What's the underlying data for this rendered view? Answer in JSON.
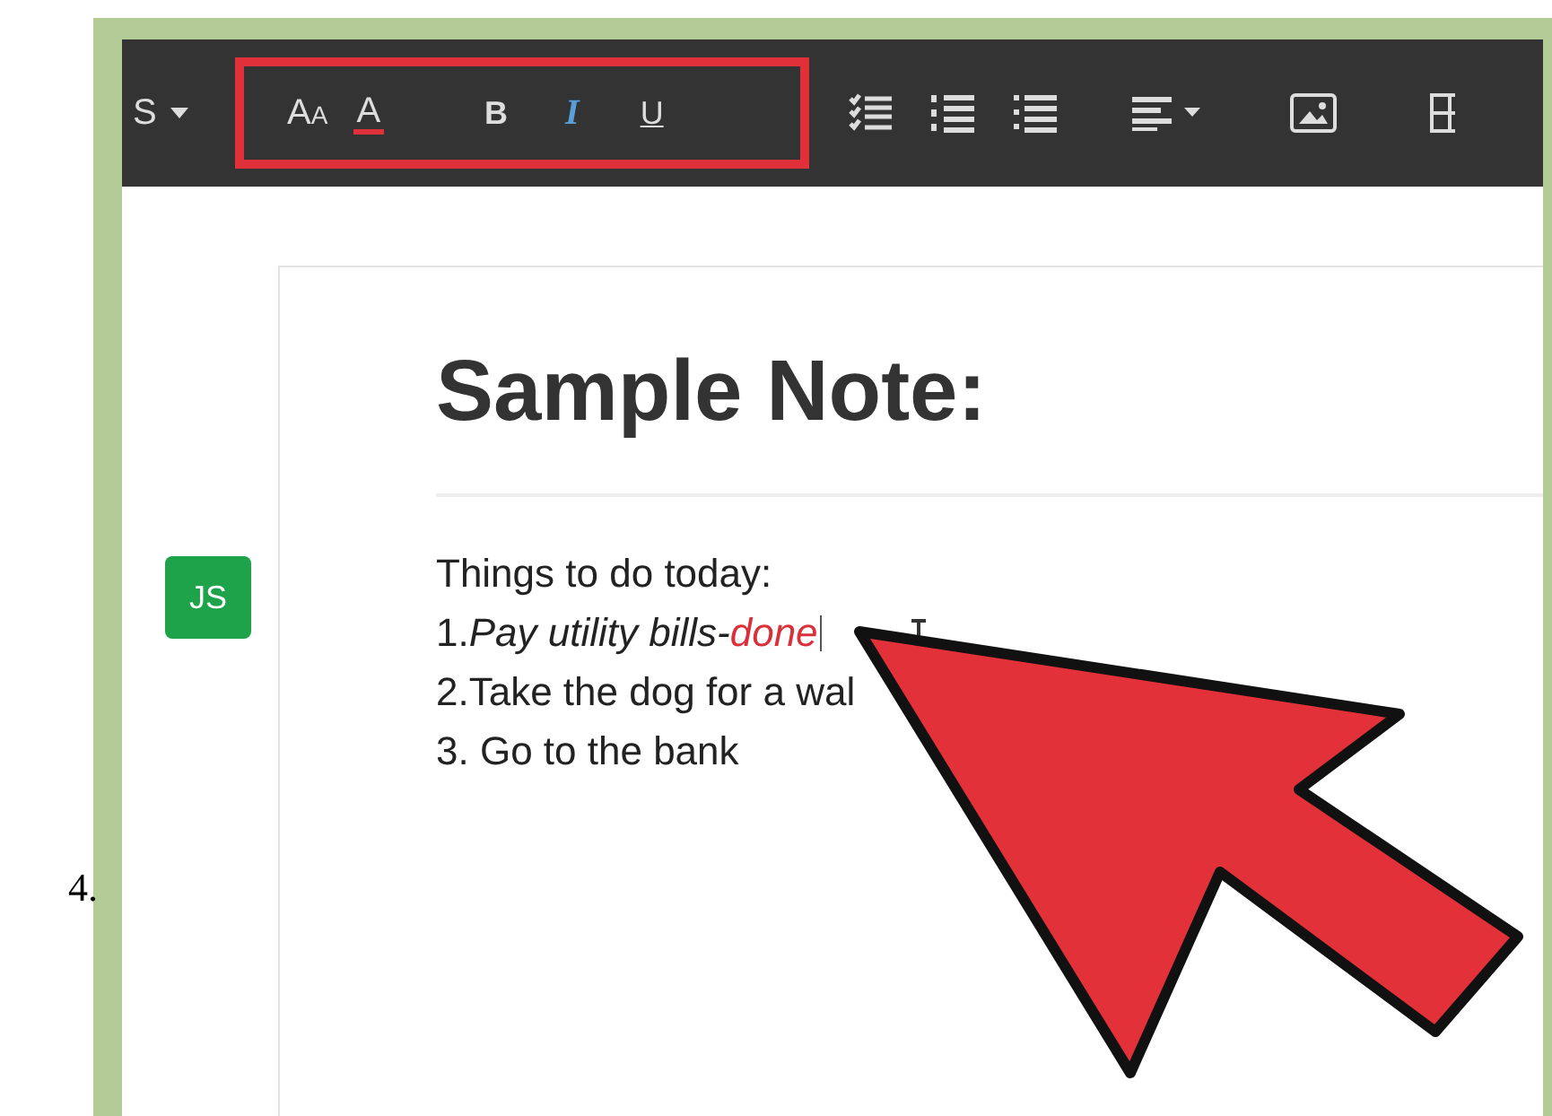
{
  "step": "4.",
  "toolbar": {
    "cut_label": "S",
    "format_buttons": [
      {
        "kind": "size",
        "label": "AA",
        "active": false
      },
      {
        "kind": "color",
        "label": "A",
        "active": false
      },
      {
        "kind": "bold",
        "label": "B",
        "active": false
      },
      {
        "kind": "italic",
        "label": "I",
        "active": true
      },
      {
        "kind": "underline",
        "label": "U",
        "active": false
      }
    ],
    "highlighted": true
  },
  "note": {
    "avatar": "JS",
    "title": "Sample Note:",
    "lines": [
      {
        "text": "Things to do today:"
      },
      {
        "prefix": "1.",
        "text": "Pay utility bills-",
        "highlight": "done",
        "italic": true,
        "cursor": true
      },
      {
        "text": "2.Take the dog for a wal"
      },
      {
        "text": "3. Go to the bank"
      }
    ]
  }
}
